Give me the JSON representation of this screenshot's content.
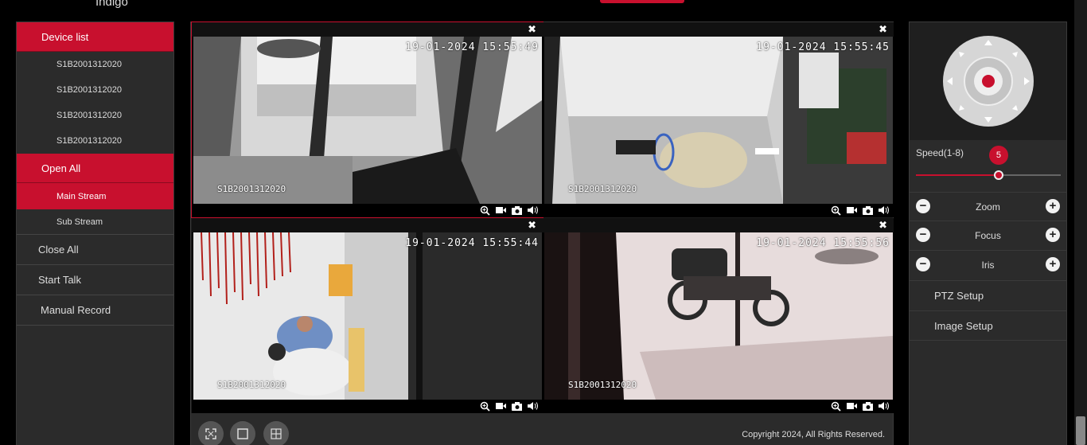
{
  "app": {
    "brand": "Indigo"
  },
  "sidebar": {
    "device_list": "Device list",
    "devices": [
      "S1B2001312020",
      "S1B2001312020",
      "S1B2001312020",
      "S1B2001312020"
    ],
    "open_all": "Open All",
    "main_stream": "Main Stream",
    "sub_stream": "Sub Stream",
    "close_all": "Close All",
    "start_talk": "Start Talk",
    "manual_record": "Manual Record"
  },
  "cameras": [
    {
      "name": "S1B2001312020",
      "timestamp": "19-01-2024 15:55:49",
      "selected": true
    },
    {
      "name": "S1B2001312020",
      "timestamp": "19-01-2024 15:55:45",
      "selected": false
    },
    {
      "name": "S1B2001312020",
      "timestamp": "19-01-2024 15:55:44",
      "selected": false
    },
    {
      "name": "S1B2001312020",
      "timestamp": "19-01-2024 15:55:56",
      "selected": false
    }
  ],
  "footer": {
    "copyright": "Copyright 2024, All Rights Reserved."
  },
  "ptz": {
    "speed_label": "Speed(1-8)",
    "speed_value": "5",
    "speed_min": 1,
    "speed_max": 8,
    "zoom": "Zoom",
    "focus": "Focus",
    "iris": "Iris",
    "ptz_setup": "PTZ Setup",
    "image_setup": "Image Setup"
  },
  "colors": {
    "accent": "#c8102e",
    "panel": "#2b2b2b",
    "background": "#000000"
  },
  "icons": [
    "close-icon",
    "zoom-in-icon",
    "record-icon",
    "snapshot-icon",
    "audio-icon",
    "fullscreen-icon",
    "single-view-icon",
    "quad-view-icon",
    "minus-icon",
    "plus-icon"
  ]
}
